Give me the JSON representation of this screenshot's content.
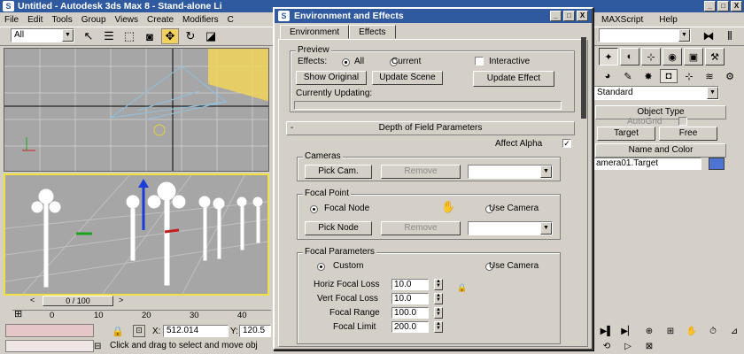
{
  "app": {
    "title": "Untitled - Autodesk 3ds Max 8 - Stand-alone Li",
    "logo": "S",
    "minimize": "_",
    "maximize": "□",
    "close": "X"
  },
  "menu": {
    "items_left": [
      "File",
      "Edit",
      "Tools",
      "Group",
      "Views",
      "Create",
      "Modifiers",
      "C"
    ],
    "items_right": [
      "MAXScript",
      "Help"
    ]
  },
  "toolbar": {
    "selection_filter": "All"
  },
  "time_slider": {
    "label": "0 / 100",
    "prev": "<",
    "next": ">"
  },
  "ruler_ticks": [
    "0",
    "10",
    "20",
    "30",
    "40"
  ],
  "status": {
    "x_label": "X:",
    "x_value": "512.014",
    "y_label": "Y:",
    "y_value": "120.5",
    "prompt": "Click and drag to select and move obj"
  },
  "command_panel": {
    "category_combo": "Standard",
    "object_type_header": "Object Type",
    "autogrid_label": "AutoGrid",
    "btn_target": "Target",
    "btn_free": "Free",
    "name_color_header": "Name and Color",
    "object_name": "amera01.Target",
    "object_color": "#4d74d2"
  },
  "dialog": {
    "title": "Environment and Effects",
    "logo": "S",
    "tabs": [
      "Environment",
      "Effects"
    ],
    "preview": {
      "title": "Preview",
      "effects_label": "Effects:",
      "radio_all": "All",
      "radio_current": "Current",
      "interactive_label": "Interactive",
      "show_original": "Show Original",
      "update_scene": "Update Scene",
      "update_effect": "Update Effect",
      "currently_updating": "Currently Updating:"
    },
    "dof": {
      "header": "Depth of Field Parameters",
      "collapse": "-",
      "affect_alpha_label": "Affect Alpha",
      "affect_alpha_check": "✓",
      "cameras_title": "Cameras",
      "pick_cam": "Pick Cam.",
      "remove": "Remove",
      "focal_point_title": "Focal Point",
      "focal_node": "Focal Node",
      "use_camera": "Use Camera",
      "pick_node": "Pick Node",
      "focal_params_title": "Focal Parameters",
      "custom": "Custom",
      "use_camera_2": "Use Camera",
      "horiz_label": "Horiz Focal Loss",
      "horiz_value": "10.0",
      "vert_label": "Vert Focal Loss",
      "vert_value": "10.0",
      "range_label": "Focal Range",
      "range_value": "100.0",
      "limit_label": "Focal Limit",
      "limit_value": "200.0"
    }
  }
}
